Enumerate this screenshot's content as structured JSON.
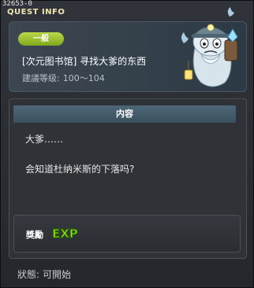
{
  "window": {
    "quest_id": "32653-0",
    "title": "QUEST INFO"
  },
  "quest": {
    "category": "一般",
    "name": "[次元图书馆] 寻找大爹的东西",
    "level_label": "建議等级:",
    "level_range": "100～104"
  },
  "content": {
    "header": "内容",
    "lines": [
      "大爹……",
      "会知道杜纳米斯的下落吗?"
    ]
  },
  "reward": {
    "label": "獎勵",
    "exp_text": "EXP"
  },
  "status": {
    "label": "狀態:",
    "value": "可開始"
  },
  "colors": {
    "badge_green": "#9cc832",
    "header_bar": "#4d6676",
    "exp_green": "#7ee21a"
  },
  "icons": {
    "npc": "ghost-miner-portrait",
    "reward": "exp-icon"
  }
}
